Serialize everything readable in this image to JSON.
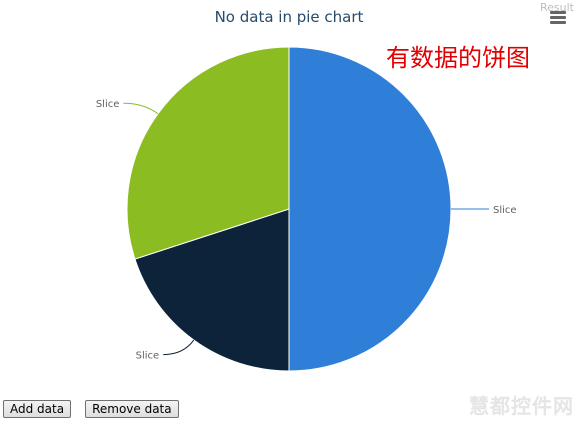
{
  "header": {
    "result_label": "Result"
  },
  "annotation": {
    "text": "有数据的饼图"
  },
  "chart_data": {
    "type": "pie",
    "title": "No data in pie chart",
    "slices": [
      {
        "label": "Slice",
        "value": 50,
        "color": "#2f7ed8"
      },
      {
        "label": "Slice",
        "value": 20,
        "color": "#0d233a"
      },
      {
        "label": "Slice",
        "value": 30,
        "color": "#8bbc21"
      }
    ]
  },
  "controls": {
    "add_label": "Add data",
    "remove_label": "Remove data"
  },
  "watermark": {
    "text": "慧都控件网"
  }
}
